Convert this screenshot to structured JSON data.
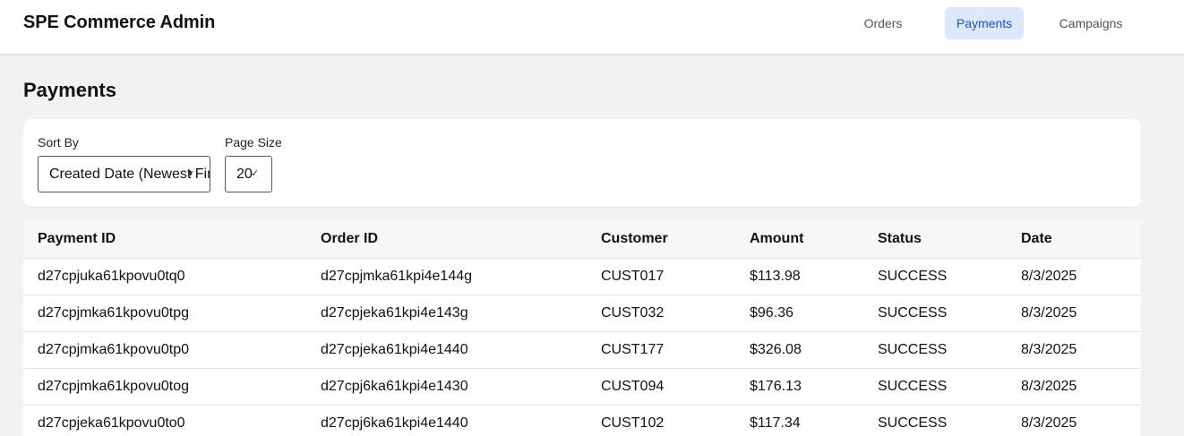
{
  "app": {
    "title": "SPE Commerce Admin"
  },
  "nav": {
    "items": [
      {
        "label": "Orders",
        "active": false
      },
      {
        "label": "Payments",
        "active": true
      },
      {
        "label": "Campaigns",
        "active": false
      }
    ]
  },
  "page": {
    "title": "Payments"
  },
  "filters": {
    "sort_by": {
      "label": "Sort By",
      "value": "Created Date (Newest First)"
    },
    "page_size": {
      "label": "Page Size",
      "value": "20"
    }
  },
  "table": {
    "columns": [
      "Payment ID",
      "Order ID",
      "Customer",
      "Amount",
      "Status",
      "Date"
    ],
    "rows": [
      [
        "d27cpjuka61kpovu0tq0",
        "d27cpjmka61kpi4e144g",
        "CUST017",
        "$113.98",
        "SUCCESS",
        "8/3/2025"
      ],
      [
        "d27cpjmka61kpovu0tpg",
        "d27cpjeka61kpi4e143g",
        "CUST032",
        "$96.36",
        "SUCCESS",
        "8/3/2025"
      ],
      [
        "d27cpjmka61kpovu0tp0",
        "d27cpjeka61kpi4e1440",
        "CUST177",
        "$326.08",
        "SUCCESS",
        "8/3/2025"
      ],
      [
        "d27cpjmka61kpovu0tog",
        "d27cpj6ka61kpi4e1430",
        "CUST094",
        "$176.13",
        "SUCCESS",
        "8/3/2025"
      ],
      [
        "d27cpjeka61kpovu0to0",
        "d27cpj6ka61kpi4e1440",
        "CUST102",
        "$117.34",
        "SUCCESS",
        "8/3/2025"
      ]
    ]
  },
  "colors": {
    "accent": "#1f4fc1",
    "accent_bg": "#dde7fb",
    "page_bg": "#f2f2f3"
  }
}
